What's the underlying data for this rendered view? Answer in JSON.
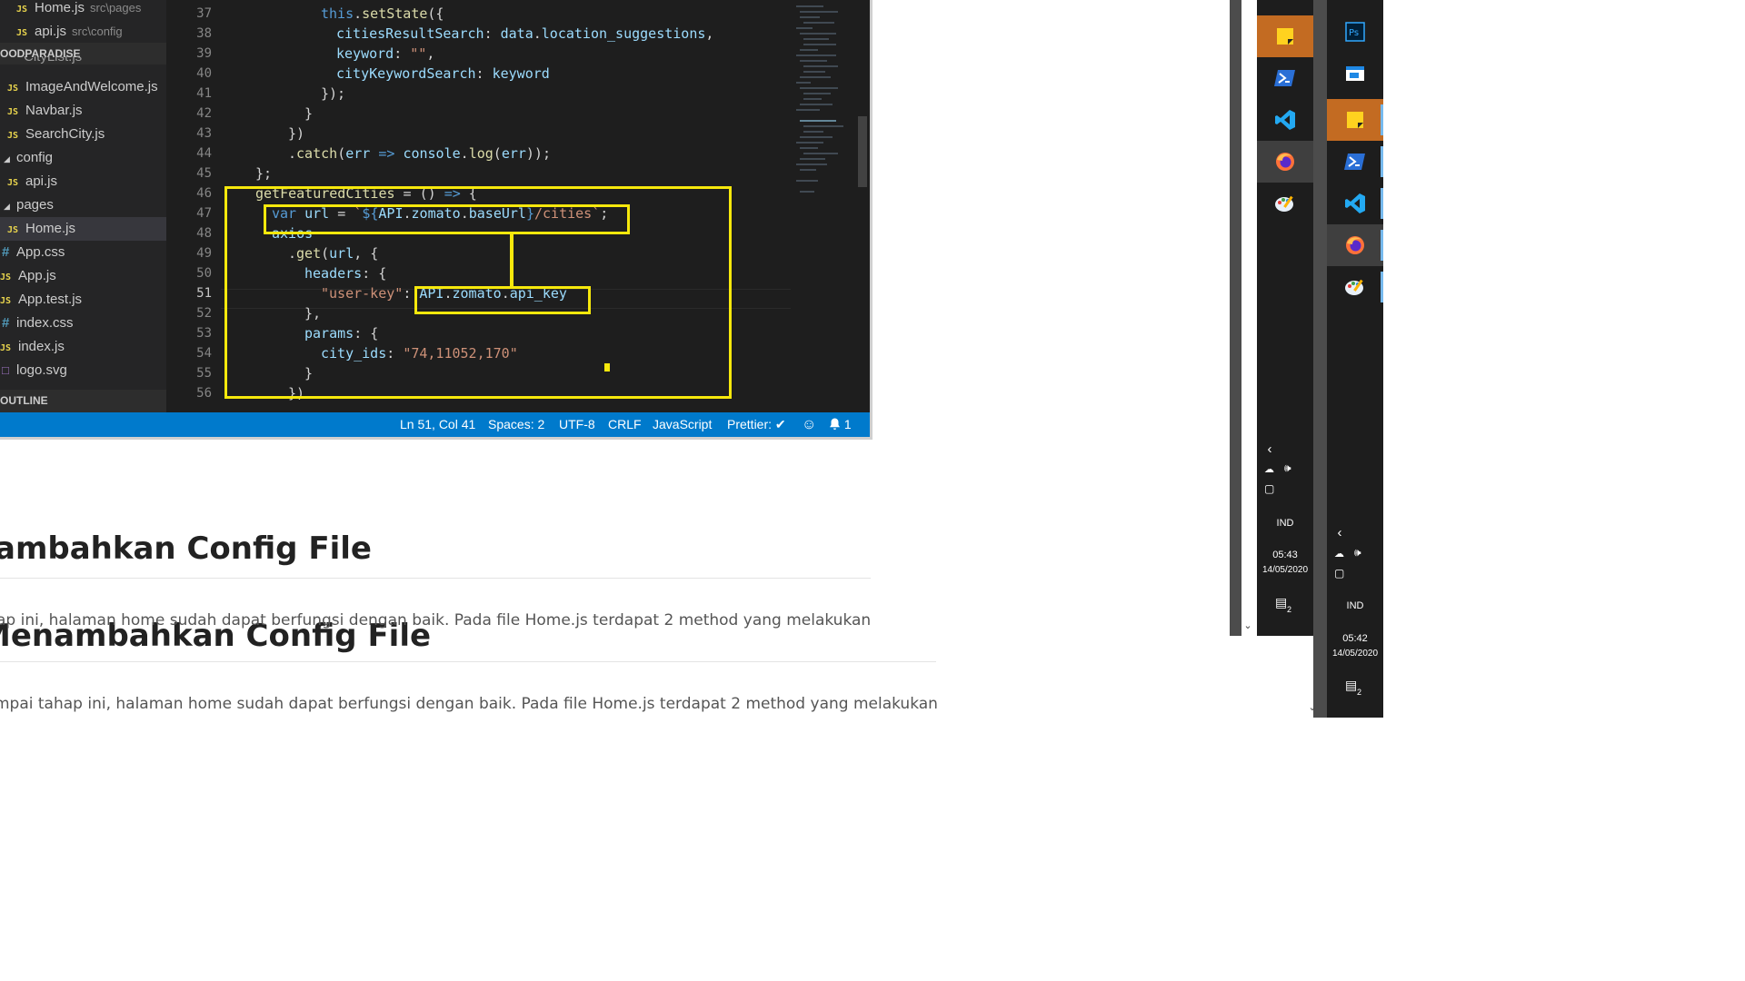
{
  "page": {
    "heading_front": "ambahkan Config File",
    "heading_back": "Menambahkan Config File",
    "para_front": "ap ini, halaman home sudah dapat berfungsi dengan baik. Pada file Home.js terdapat 2 method yang melakukan",
    "para_back": "mpai tahap ini, halaman home sudah dapat berfungsi dengan baik. Pada file Home.js terdapat 2 method yang melakukan"
  },
  "explorer": {
    "open_editors": [
      {
        "name": "Home.js",
        "path": "src\\pages",
        "icon": "JS"
      },
      {
        "name": "api.js",
        "path": "src\\config",
        "icon": "JS"
      }
    ],
    "project": "OODPARADISE",
    "cut_item": "CityList.js",
    "files": [
      {
        "name": "ImageAndWelcome.js",
        "icon": "JS"
      },
      {
        "name": "Navbar.js",
        "icon": "JS"
      },
      {
        "name": "SearchCity.js",
        "icon": "JS"
      },
      {
        "name": "config",
        "icon": "folder-open"
      },
      {
        "name": "api.js",
        "icon": "JS"
      },
      {
        "name": "pages",
        "icon": "folder-open"
      },
      {
        "name": "Home.js",
        "icon": "JS",
        "selected": true
      },
      {
        "name": "App.css",
        "icon": "#"
      },
      {
        "name": "App.js",
        "icon": "JS"
      },
      {
        "name": "App.test.js",
        "icon": "JS"
      },
      {
        "name": "index.css",
        "icon": "#"
      },
      {
        "name": "index.js",
        "icon": "JS"
      },
      {
        "name": "logo.svg",
        "icon": "svg"
      }
    ],
    "outline": "OUTLINE"
  },
  "editor": {
    "line_numbers": [
      "37",
      "38",
      "39",
      "40",
      "41",
      "42",
      "43",
      "44",
      "45",
      "46",
      "47",
      "48",
      "49",
      "50",
      "51",
      "52",
      "53",
      "54",
      "55",
      "56"
    ],
    "current_line": "51"
  },
  "statusbar": {
    "position": "Ln 51, Col 41",
    "spaces": "Spaces: 2",
    "encoding": "UTF-8",
    "eol": "CRLF",
    "language": "JavaScript",
    "prettier": "Prettier: ✔",
    "notifications": "1"
  },
  "taskbar_front": {
    "lang": "IND",
    "time": "05:43",
    "date": "14/05/2020",
    "notif_count": "2",
    "apps": [
      "sticky-notes-icon",
      "powershell-icon",
      "vscode-icon",
      "firefox-icon",
      "paint-icon"
    ]
  },
  "taskbar_back": {
    "lang": "IND",
    "time": "05:42",
    "date": "14/05/2020",
    "notif_count": "2",
    "apps": [
      "photoshop-icon",
      "window-icon",
      "sticky-notes-icon",
      "powershell-icon",
      "vscode-icon",
      "firefox-icon",
      "paint-icon"
    ]
  },
  "colors": {
    "highlight": "#f6e80c",
    "statusbar": "#007acc",
    "taskbar_active": "#c36b22"
  }
}
